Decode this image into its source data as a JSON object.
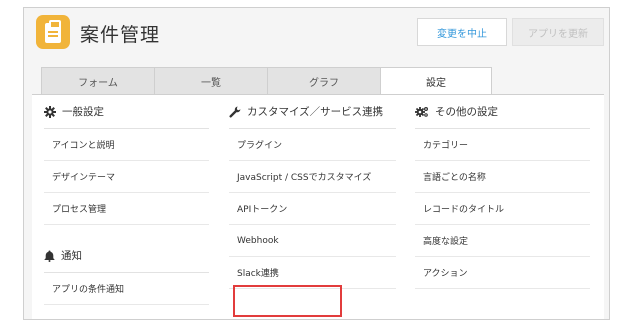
{
  "app": {
    "title": "案件管理"
  },
  "header": {
    "cancel_label": "変更を中止",
    "update_label": "アプリを更新"
  },
  "tabs": [
    {
      "label": "フォーム"
    },
    {
      "label": "一覧"
    },
    {
      "label": "グラフ"
    },
    {
      "label": "設定"
    }
  ],
  "active_tab": "設定",
  "sections": {
    "general": {
      "title": "一般設定",
      "icon": "gear-icon",
      "items": [
        "アイコンと説明",
        "デザインテーマ",
        "プロセス管理"
      ]
    },
    "notifications": {
      "title": "通知",
      "icon": "bell-icon",
      "items": [
        "アプリの条件通知"
      ]
    },
    "customize": {
      "title": "カスタマイズ／サービス連携",
      "icon": "wrench-icon",
      "items": [
        "プラグイン",
        "JavaScript / CSSでカスタマイズ",
        "APIトークン",
        "Webhook",
        "Slack連携"
      ]
    },
    "other": {
      "title": "その他の設定",
      "icon": "gears-icon",
      "items": [
        "カテゴリー",
        "言語ごとの名称",
        "レコードのタイトル",
        "高度な設定",
        "アクション"
      ]
    }
  },
  "highlighted_item": "Slack連携",
  "colors": {
    "accent": "#3498db",
    "app_icon": "#f1b43a",
    "highlight": "#e23c3c"
  }
}
